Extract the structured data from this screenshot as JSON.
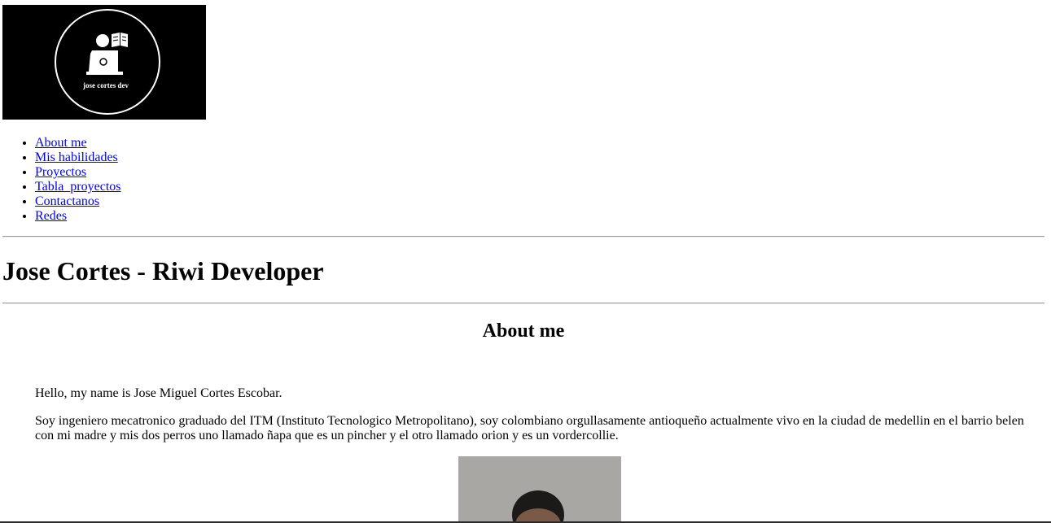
{
  "logo": {
    "text": "jose cortes dev",
    "icon": "developer-reading-laptop-icon",
    "background": "#000000",
    "foreground": "#ffffff"
  },
  "nav": {
    "items": [
      {
        "label": "About me"
      },
      {
        "label": "Mis habilidades"
      },
      {
        "label": "Proyectos"
      },
      {
        "label": "Tabla_proyectos"
      },
      {
        "label": "Contactanos"
      },
      {
        "label": "Redes"
      }
    ],
    "link_color": "#0000ee"
  },
  "header": {
    "title": "Jose Cortes - Riwi Developer"
  },
  "about": {
    "heading": "About me",
    "paragraphs": [
      "Hello, my name is Jose Miguel Cortes Escobar.",
      "Soy ingeniero mecatronico graduado del ITM (Instituto Tecnologico Metropolitano), soy colombiano orgullasamente antioqueño actualmente vivo en la ciudad de medellin en el barrio belen con mi madre y mis dos perros uno llamado ñapa que es un pincher y el otro llamado orion y es un vordercollie."
    ],
    "photo_icon": "profile-photo"
  }
}
